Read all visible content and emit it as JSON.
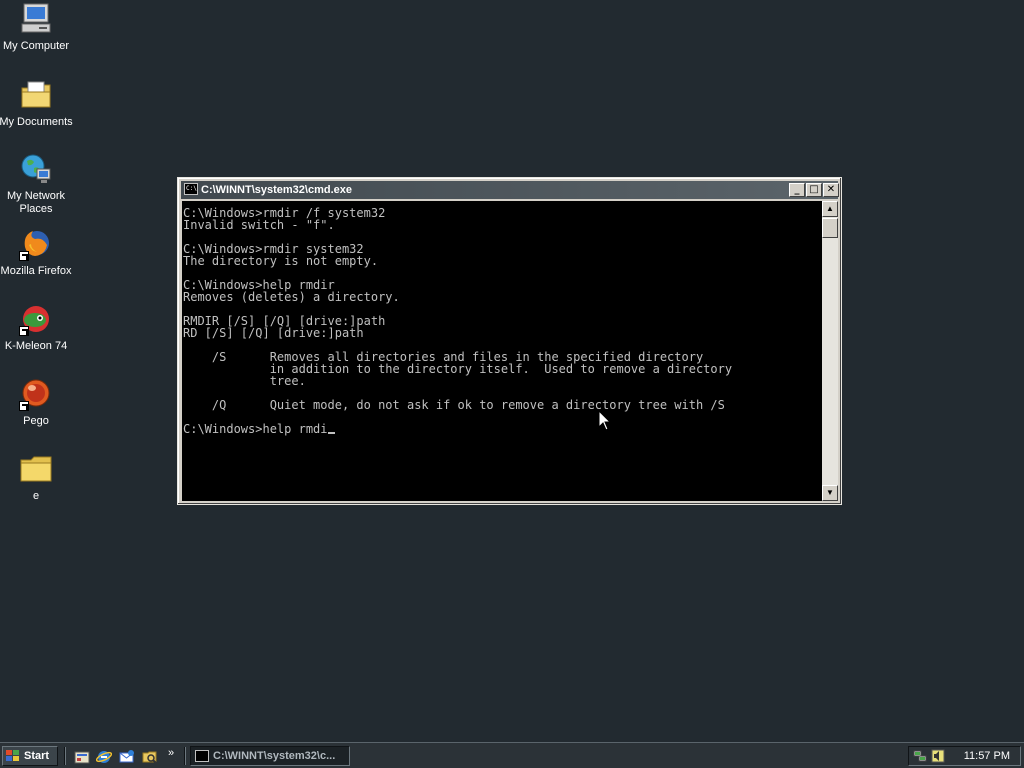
{
  "desktop": {
    "icons": [
      {
        "label": "My Computer",
        "icon": "my-computer-icon"
      },
      {
        "label": "My Documents",
        "icon": "my-documents-icon"
      },
      {
        "label": "My Network Places",
        "icon": "network-places-icon"
      },
      {
        "label": "Mozilla Firefox",
        "icon": "firefox-icon"
      },
      {
        "label": "K-Meleon 74",
        "icon": "kmeleon-icon"
      },
      {
        "label": "Pego",
        "icon": "pego-icon"
      },
      {
        "label": "e",
        "icon": "folder-icon"
      }
    ]
  },
  "window": {
    "title": "C:\\WINNT\\system32\\cmd.exe",
    "title_icon_text": "C:\\",
    "minimize": "_",
    "maximize": "□",
    "close": "✕",
    "console_lines": "C:\\Windows>rmdir /f system32\nInvalid switch - \"f\".\n\nC:\\Windows>rmdir system32\nThe directory is not empty.\n\nC:\\Windows>help rmdir\nRemoves (deletes) a directory.\n\nRMDIR [/S] [/Q] [drive:]path\nRD [/S] [/Q] [drive:]path\n\n    /S      Removes all directories and files in the specified directory\n            in addition to the directory itself.  Used to remove a directory\n            tree.\n\n    /Q      Quiet mode, do not ask if ok to remove a directory tree with /S\n\n",
    "prompt_line": "C:\\Windows>help rmdi",
    "scroll_up": "▲",
    "scroll_down": "▼"
  },
  "taskbar": {
    "start_label": "Start",
    "quicklaunch": [
      "show-desktop-icon",
      "internet-explorer-icon",
      "outlook-express-icon",
      "windows-explorer-icon"
    ],
    "more_label": "»",
    "task_button_label": "C:\\WINNT\\system32\\c...",
    "tray_icons": [
      "network-tray-icon",
      "volume-tray-icon"
    ],
    "clock": "11:57 PM"
  },
  "colors": {
    "desktop": "#222a30",
    "console_bg": "#000000",
    "console_text": "#c0c0c0",
    "titlebar": "#41494f"
  }
}
